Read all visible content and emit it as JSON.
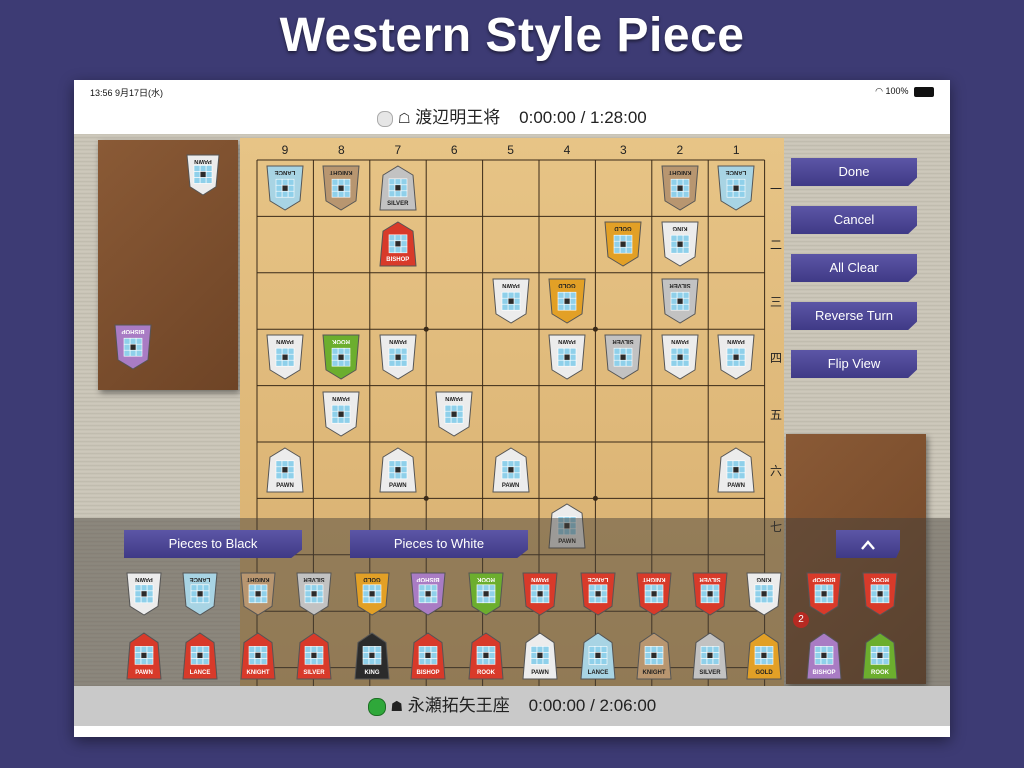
{
  "banner": {
    "title": "Western Style Piece"
  },
  "status_bar": {
    "time": "13:56  9月17日(水)",
    "battery": "100%"
  },
  "players": {
    "white": {
      "name": "渡辺明王将",
      "clock": "0:00:00 / 1:28:00"
    },
    "black": {
      "name": "永瀬拓矢王座",
      "clock": "0:00:00 / 2:06:00"
    }
  },
  "board": {
    "columns": [
      "9",
      "8",
      "7",
      "6",
      "5",
      "4",
      "3",
      "2",
      "1"
    ],
    "rows": [
      "一",
      "二",
      "三",
      "四",
      "五",
      "六",
      "七"
    ],
    "pieces": [
      {
        "label": "LANCE",
        "col": 9,
        "row": 1,
        "side": "white",
        "color": "#a8d4e4"
      },
      {
        "label": "KNIGHT",
        "col": 8,
        "row": 1,
        "side": "white",
        "color": "#b89670"
      },
      {
        "label": "SILVER",
        "col": 7,
        "row": 1,
        "side": "black",
        "color": "#c2c2c2"
      },
      {
        "label": "KNIGHT",
        "col": 2,
        "row": 1,
        "side": "white",
        "color": "#b89670"
      },
      {
        "label": "LANCE",
        "col": 1,
        "row": 1,
        "side": "white",
        "color": "#a8d4e4"
      },
      {
        "label": "BISHOP",
        "col": 7,
        "row": 2,
        "side": "black",
        "color": "#d83a2a"
      },
      {
        "label": "GOLD",
        "col": 3,
        "row": 2,
        "side": "white",
        "color": "#e2a026"
      },
      {
        "label": "KING",
        "col": 2,
        "row": 2,
        "side": "white",
        "color": "#ececec"
      },
      {
        "label": "PAWN",
        "col": 5,
        "row": 3,
        "side": "white",
        "color": "#ececec"
      },
      {
        "label": "GOLD",
        "col": 4,
        "row": 3,
        "side": "white",
        "color": "#e2a026"
      },
      {
        "label": "SILVER",
        "col": 2,
        "row": 3,
        "side": "white",
        "color": "#c2c2c2"
      },
      {
        "label": "PAWN",
        "col": 9,
        "row": 4,
        "side": "white",
        "color": "#ececec"
      },
      {
        "label": "ROOK",
        "col": 8,
        "row": 4,
        "side": "white",
        "color": "#6cae2e"
      },
      {
        "label": "PAWN",
        "col": 7,
        "row": 4,
        "side": "white",
        "color": "#ececec"
      },
      {
        "label": "PAWN",
        "col": 4,
        "row": 4,
        "side": "white",
        "color": "#ececec"
      },
      {
        "label": "SILVER",
        "col": 3,
        "row": 4,
        "side": "white",
        "color": "#c2c2c2"
      },
      {
        "label": "PAWN",
        "col": 2,
        "row": 4,
        "side": "white",
        "color": "#ececec"
      },
      {
        "label": "PAWN",
        "col": 1,
        "row": 4,
        "side": "white",
        "color": "#ececec"
      },
      {
        "label": "PAWN",
        "col": 8,
        "row": 5,
        "side": "white",
        "color": "#ececec"
      },
      {
        "label": "PAWN",
        "col": 6,
        "row": 5,
        "side": "white",
        "color": "#ececec"
      },
      {
        "label": "PAWN",
        "col": 9,
        "row": 6,
        "side": "black",
        "color": "#ececec"
      },
      {
        "label": "PAWN",
        "col": 7,
        "row": 6,
        "side": "black",
        "color": "#ececec"
      },
      {
        "label": "PAWN",
        "col": 5,
        "row": 6,
        "side": "black",
        "color": "#ececec"
      },
      {
        "label": "PAWN",
        "col": 1,
        "row": 6,
        "side": "black",
        "color": "#ececec"
      },
      {
        "label": "PAWN",
        "col": 4,
        "row": 7,
        "side": "black",
        "color": "#ececec"
      }
    ]
  },
  "white_hand": [
    {
      "label": "PAWN",
      "color": "#ececec"
    },
    {
      "label": "BISHOP",
      "color": "#a97cc4"
    }
  ],
  "side_buttons": [
    "Done",
    "Cancel",
    "All Clear",
    "Reverse Turn",
    "Flip View"
  ],
  "palette": {
    "pieces_to_black": "Pieces to Black",
    "pieces_to_white": "Pieces to White",
    "collapse_icon": "chevron-up-icon",
    "white_row": [
      {
        "label": "PAWN",
        "color": "#ececec"
      },
      {
        "label": "LANCE",
        "color": "#a8d4e4"
      },
      {
        "label": "KNIGHT",
        "color": "#b89670"
      },
      {
        "label": "SILVER",
        "color": "#c2c2c2"
      },
      {
        "label": "GOLD",
        "color": "#e2a026"
      },
      {
        "label": "BISHOP",
        "color": "#a97cc4"
      },
      {
        "label": "ROOK",
        "color": "#6cae2e"
      },
      {
        "label": "PAWN",
        "color": "#d83a2a"
      },
      {
        "label": "LANCE",
        "color": "#d83a2a"
      },
      {
        "label": "KNIGHT",
        "color": "#d83a2a"
      },
      {
        "label": "SILVER",
        "color": "#d83a2a"
      },
      {
        "label": "KING",
        "color": "#ececec"
      },
      {
        "label": "BISHOP",
        "color": "#d83a2a"
      },
      {
        "label": "ROOK",
        "color": "#d83a2a"
      }
    ],
    "black_row": [
      {
        "label": "PAWN",
        "color": "#d83a2a"
      },
      {
        "label": "LANCE",
        "color": "#d83a2a"
      },
      {
        "label": "KNIGHT",
        "color": "#d83a2a"
      },
      {
        "label": "SILVER",
        "color": "#d83a2a"
      },
      {
        "label": "KING",
        "color": "#2b2b2b"
      },
      {
        "label": "BISHOP",
        "color": "#d83a2a"
      },
      {
        "label": "ROOK",
        "color": "#d83a2a"
      },
      {
        "label": "PAWN",
        "color": "#ececec"
      },
      {
        "label": "LANCE",
        "color": "#a8d4e4"
      },
      {
        "label": "KNIGHT",
        "color": "#b89670"
      },
      {
        "label": "SILVER",
        "color": "#c2c2c2"
      },
      {
        "label": "GOLD",
        "color": "#e2a026"
      },
      {
        "label": "BISHOP",
        "color": "#a97cc4"
      },
      {
        "label": "ROOK",
        "color": "#6cae2e"
      }
    ],
    "bishop_count": "2"
  },
  "colors": {
    "accent": "#4a449a",
    "background": "#3d3b74",
    "board": "#deb878",
    "black_indicator": "#3cb043"
  }
}
